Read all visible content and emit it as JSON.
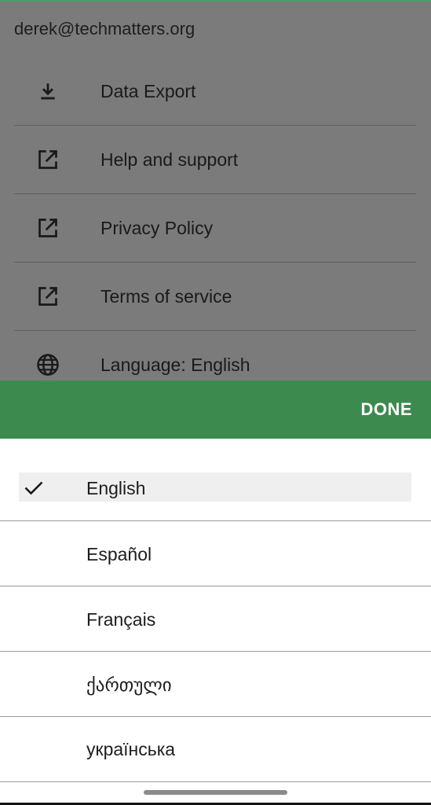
{
  "account": {
    "email": "derek@techmatters.org"
  },
  "menu": {
    "items": [
      {
        "label": "Data Export",
        "icon": "download-icon"
      },
      {
        "label": "Help and support",
        "icon": "external-link-icon"
      },
      {
        "label": "Privacy Policy",
        "icon": "external-link-icon"
      },
      {
        "label": "Terms of service",
        "icon": "external-link-icon"
      },
      {
        "label": "Language: English",
        "icon": "globe-icon"
      }
    ]
  },
  "language_picker": {
    "done_label": "DONE",
    "selected": "English",
    "options": [
      "English",
      "Español",
      "Français",
      "ქართული",
      "українська"
    ]
  },
  "colors": {
    "accent_green": "#3d8a4f",
    "backdrop": "#7b7b7b"
  }
}
